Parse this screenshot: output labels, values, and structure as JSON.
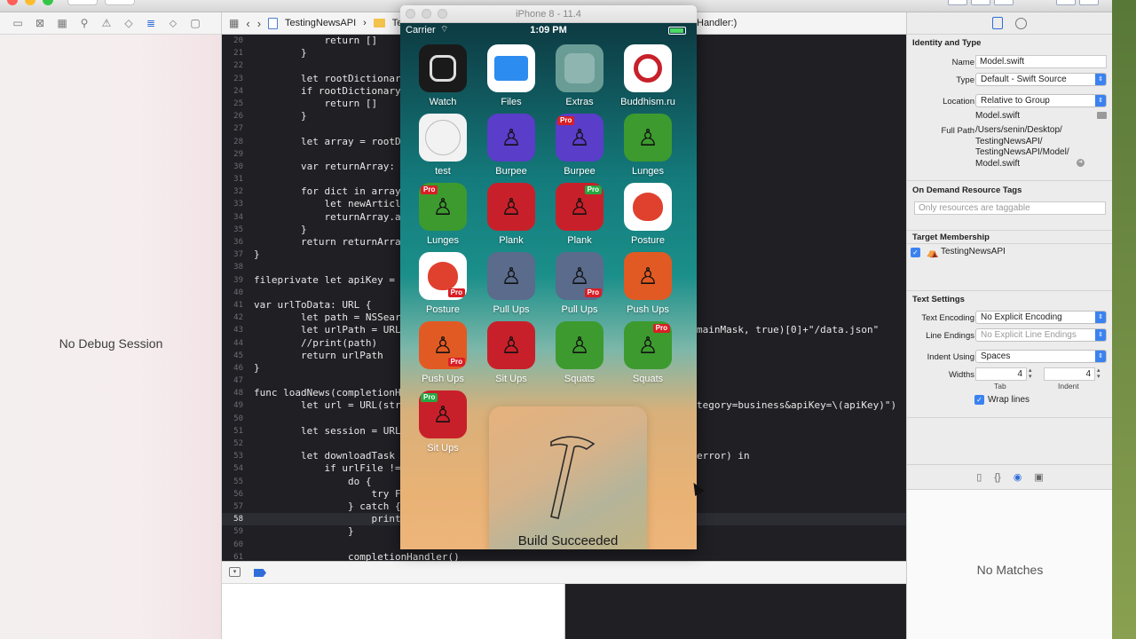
{
  "navigator": {
    "empty_text": "No Debug Session"
  },
  "jumpbar": {
    "project": "TestingNewsAPI",
    "folder": "Te",
    "tail": "Handler:)"
  },
  "editor": {
    "current_line": "58",
    "lines": [
      {
        "n": "20",
        "t": "            return []"
      },
      {
        "n": "21",
        "t": "        }"
      },
      {
        "n": "22",
        "t": ""
      },
      {
        "n": "23",
        "t": "        let rootDictionary = r"
      },
      {
        "n": "24",
        "t": "        if rootDictionary == n"
      },
      {
        "n": "25",
        "t": "            return []"
      },
      {
        "n": "26",
        "t": "        }"
      },
      {
        "n": "27",
        "t": ""
      },
      {
        "n": "28",
        "t": "        let array = rootDictio"
      },
      {
        "n": "29",
        "t": ""
      },
      {
        "n": "30",
        "t": "        var returnArray: [News"
      },
      {
        "n": "31",
        "t": ""
      },
      {
        "n": "32",
        "t": "        for dict in array {"
      },
      {
        "n": "33",
        "t": "            let newArticle = N"
      },
      {
        "n": "34",
        "t": "            returnArray.append"
      },
      {
        "n": "35",
        "t": "        }"
      },
      {
        "n": "36",
        "t": "        return returnArray"
      },
      {
        "n": "37",
        "t": "}"
      },
      {
        "n": "38",
        "t": ""
      },
      {
        "n": "39",
        "t": "fileprivate let apiKey = \""
      },
      {
        "n": "40",
        "t": ""
      },
      {
        "n": "41",
        "t": "var urlToData: URL {"
      },
      {
        "n": "42",
        "t": "        let path = NSSearchPat"
      },
      {
        "n": "43",
        "t": "        let urlPath = URL(file"
      },
      {
        "n": "44",
        "t": "        //print(path)"
      },
      {
        "n": "45",
        "t": "        return urlPath"
      },
      {
        "n": "46",
        "t": "}"
      },
      {
        "n": "47",
        "t": ""
      },
      {
        "n": "48",
        "t": "func loadNews(completionHa"
      },
      {
        "n": "49",
        "t": "        let url = URL(string:"
      },
      {
        "n": "50",
        "t": ""
      },
      {
        "n": "51",
        "t": "        let session = URLSessi"
      },
      {
        "n": "52",
        "t": ""
      },
      {
        "n": "53",
        "t": "        let downloadTask = ses"
      },
      {
        "n": "54",
        "t": "            if urlFile != nil"
      },
      {
        "n": "55",
        "t": "                do {"
      },
      {
        "n": "56",
        "t": "                    try FileMa"
      },
      {
        "n": "57",
        "t": "                } catch {"
      },
      {
        "n": "58",
        "t": "                    print(erro"
      },
      {
        "n": "59",
        "t": "                }"
      },
      {
        "n": "60",
        "t": ""
      },
      {
        "n": "61",
        "t": "                completionHandler()"
      }
    ],
    "right_fragments": {
      "l43": "mainMask, true)[0]+\"/data.json\"",
      "l49": "tegory=business&apiKey=\\(apiKey)\")",
      "l53": "error) in"
    }
  },
  "simulator": {
    "title": "iPhone 8 - 11.4",
    "carrier": "Carrier",
    "time": "1:09 PM",
    "pro_tag": "Pro",
    "apps": [
      {
        "label": "Watch",
        "color": "#1a1a1a"
      },
      {
        "label": "Files",
        "color": "#ffffff"
      },
      {
        "label": "Extras",
        "color": "#6a9c96"
      },
      {
        "label": "Buddhism.ru",
        "color": "#ffffff"
      },
      {
        "label": "test",
        "color": "#f2f2f2"
      },
      {
        "label": "Burpee",
        "color": "#5a3dc8"
      },
      {
        "label": "Burpee",
        "color": "#5a3dc8"
      },
      {
        "label": "Lunges",
        "color": "#3d9a2f"
      },
      {
        "label": "Lunges",
        "color": "#3d9a2f"
      },
      {
        "label": "Plank",
        "color": "#c8202a"
      },
      {
        "label": "Plank",
        "color": "#c8202a"
      },
      {
        "label": "Posture",
        "color": "#ffffff"
      },
      {
        "label": "Posture",
        "color": "#ffffff"
      },
      {
        "label": "Pull Ups",
        "color": "#5a6b8c"
      },
      {
        "label": "Pull Ups",
        "color": "#5a6b8c"
      },
      {
        "label": "Push Ups",
        "color": "#e25a23"
      },
      {
        "label": "Push Ups",
        "color": "#e25a23"
      },
      {
        "label": "Sit Ups",
        "color": "#c8202a"
      },
      {
        "label": "Squats",
        "color": "#3d9a2f"
      },
      {
        "label": "Squats",
        "color": "#3d9a2f"
      },
      {
        "label": "Sit Ups",
        "color": "#c8202a"
      }
    ],
    "hud_message": "Build Succeeded"
  },
  "inspector": {
    "identity_title": "Identity and Type",
    "name_label": "Name",
    "name_value": "Model.swift",
    "type_label": "Type",
    "type_value": "Default - Swift Source",
    "location_label": "Location",
    "location_value": "Relative to Group",
    "location_file": "Model.swift",
    "fullpath_label": "Full Path",
    "fullpath_lines": [
      "/Users/senin/Desktop/",
      "TestingNewsAPI/",
      "TestingNewsAPI/Model/",
      "Model.swift"
    ],
    "ondemand_title": "On Demand Resource Tags",
    "ondemand_placeholder": "Only resources are taggable",
    "target_title": "Target Membership",
    "target_name": "TestingNewsAPI",
    "text_title": "Text Settings",
    "encoding_label": "Text Encoding",
    "encoding_value": "No Explicit Encoding",
    "lineend_label": "Line Endings",
    "lineend_value": "No Explicit Line Endings",
    "indent_label": "Indent Using",
    "indent_value": "Spaces",
    "widths_label": "Widths",
    "tab_value": "4",
    "indent_width_value": "4",
    "tab_caption": "Tab",
    "indent_caption": "Indent",
    "wrap_label": "Wrap lines",
    "no_matches": "No Matches"
  }
}
